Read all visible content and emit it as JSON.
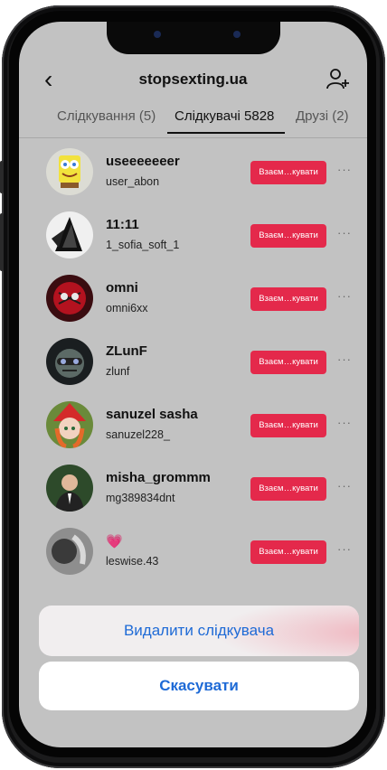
{
  "header": {
    "title": "stopsexting.ua"
  },
  "tabs": [
    {
      "label": "Слідкування (5)"
    },
    {
      "label": "Слідкувачі 5828"
    },
    {
      "label": "Друзі (2)"
    }
  ],
  "rows": [
    {
      "name": "useeeeeeer",
      "username": "user_abon",
      "button": "Взаєм…кувати"
    },
    {
      "name": "11:11",
      "username": "1_sofia_soft_1",
      "button": "Взаєм…кувати"
    },
    {
      "name": "omni",
      "username": "omni6xx",
      "button": "Взаєм…кувати"
    },
    {
      "name": "ZLunF",
      "username": "zlunf",
      "button": "Взаєм…кувати"
    },
    {
      "name": "sanuzel sasha",
      "username": "sanuzel228_",
      "button": "Взаєм…кувати"
    },
    {
      "name": "misha_grommm",
      "username": "mg389834dnt",
      "button": "Взаєм…кувати"
    },
    {
      "name": "💗",
      "username": "leswise.43",
      "button": "Взаєм…кувати"
    }
  ],
  "more_label": "···",
  "sheet": {
    "action": "Видалити слідкувача",
    "cancel": "Скасувати"
  },
  "colors": {
    "follow_button": "#e4294b",
    "sheet_text": "#1e6ad6"
  }
}
